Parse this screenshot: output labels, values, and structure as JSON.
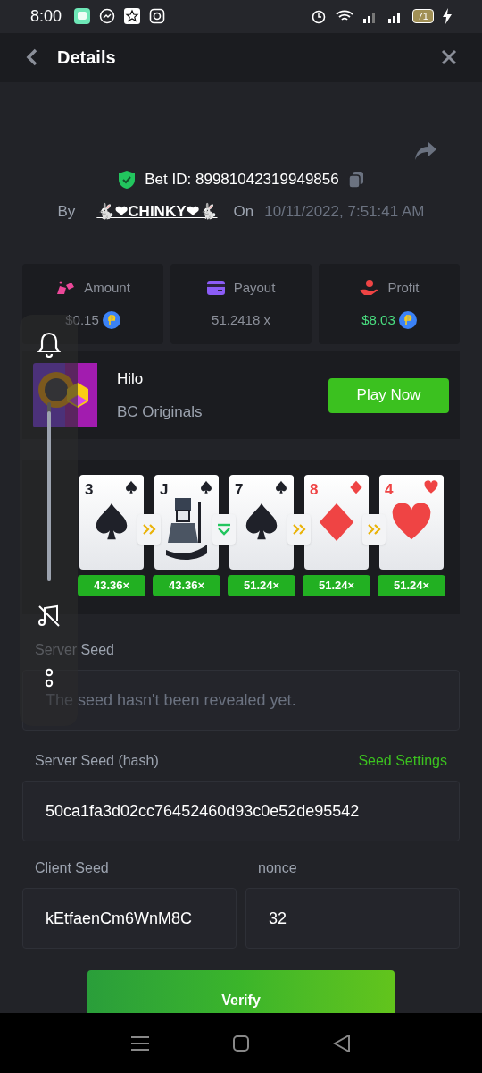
{
  "status_bar": {
    "time": "8:00",
    "battery": "71"
  },
  "header": {
    "title": "Details"
  },
  "bet": {
    "id_label": "Bet ID: 89981042319949856",
    "by_label": "By",
    "user": "🐇❤CHINKY❤🐇",
    "on_label": "On",
    "date": "10/11/2022, 7:51:41 AM"
  },
  "stats": [
    {
      "kind": "amount",
      "label": "Amount",
      "value": "$0.15",
      "coin": true,
      "positive": false
    },
    {
      "kind": "payout",
      "label": "Payout",
      "value": "51.2418 x",
      "coin": false,
      "positive": false
    },
    {
      "kind": "profit",
      "label": "Profit",
      "value": "$8.03",
      "coin": true,
      "positive": true
    }
  ],
  "game": {
    "name": "Hilo",
    "provider": "BC Originals",
    "button": "Play Now"
  },
  "cards": [
    {
      "rank": "3",
      "kind": "spade",
      "multiplier": "43.36×"
    },
    {
      "rank": "J",
      "kind": "spade",
      "multiplier": "43.36×"
    },
    {
      "rank": "7",
      "kind": "spade",
      "multiplier": "51.24×"
    },
    {
      "rank": "8",
      "kind": "diamond",
      "multiplier": "51.24×"
    },
    {
      "rank": "4",
      "kind": "heart",
      "multiplier": "51.24×"
    }
  ],
  "moves": [
    {
      "kind": "skip"
    },
    {
      "kind": "lower"
    },
    {
      "kind": "skip"
    },
    {
      "kind": "skip"
    }
  ],
  "server_seed": {
    "label": "Server Seed",
    "placeholder": "The seed hasn't been revealed yet."
  },
  "server_hash": {
    "label": "Server Seed (hash)",
    "link": "Seed Settings",
    "value": "50ca1fa3d02cc76452460d93c0e52de95542"
  },
  "client_seed": {
    "label": "Client Seed",
    "value": "kEtfaenCm6WnM8C"
  },
  "nonce": {
    "label": "nonce",
    "value": "32"
  },
  "verify": {
    "label": "Verify"
  },
  "overlay": {
    "level": 0.95
  }
}
